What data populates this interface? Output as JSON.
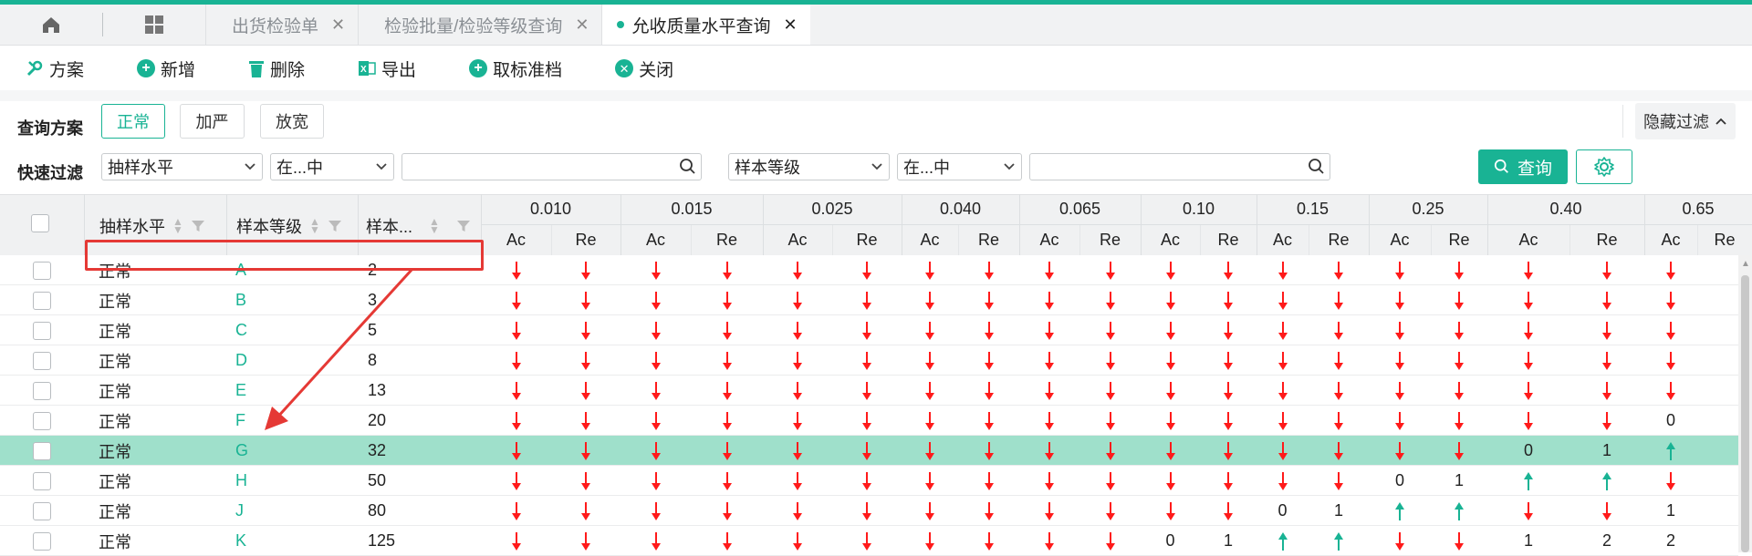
{
  "tabs": {
    "items": [
      {
        "label": "出货检验单"
      },
      {
        "label": "检验批量/检验等级查询"
      },
      {
        "label": "允收质量水平查询"
      }
    ]
  },
  "toolbar": {
    "scheme": "方案",
    "add": "新增",
    "delete": "删除",
    "export": "导出",
    "cancel_std": "取标准档",
    "close": "关闭"
  },
  "query": {
    "scheme_label": "查询方案",
    "chips": [
      "正常",
      "加严",
      "放宽"
    ],
    "hide_filter": "隐藏过滤",
    "quick_label": "快速过滤",
    "field1": "抽样水平",
    "op1": "在...中",
    "field2": "样本等级",
    "op2": "在...中",
    "search": "查询"
  },
  "grid": {
    "col_level": "抽样水平",
    "col_grade": "样本等级",
    "col_size": "样本...",
    "aql": [
      "0.010",
      "0.015",
      "0.025",
      "0.040",
      "0.065",
      "0.10",
      "0.15",
      "0.25",
      "0.40",
      "0.65"
    ],
    "ac": "Ac",
    "re": "Re",
    "rows": [
      {
        "level": "正常",
        "grade": "A",
        "size": "2",
        "cells": [
          "d",
          "d",
          "d",
          "d",
          "d",
          "d",
          "d",
          "d",
          "d",
          "d",
          "d",
          "d",
          "d",
          "d",
          "d",
          "d",
          "d",
          "d",
          "d"
        ]
      },
      {
        "level": "正常",
        "grade": "B",
        "size": "3",
        "cells": [
          "d",
          "d",
          "d",
          "d",
          "d",
          "d",
          "d",
          "d",
          "d",
          "d",
          "d",
          "d",
          "d",
          "d",
          "d",
          "d",
          "d",
          "d",
          "d"
        ]
      },
      {
        "level": "正常",
        "grade": "C",
        "size": "5",
        "cells": [
          "d",
          "d",
          "d",
          "d",
          "d",
          "d",
          "d",
          "d",
          "d",
          "d",
          "d",
          "d",
          "d",
          "d",
          "d",
          "d",
          "d",
          "d",
          "d"
        ]
      },
      {
        "level": "正常",
        "grade": "D",
        "size": "8",
        "cells": [
          "d",
          "d",
          "d",
          "d",
          "d",
          "d",
          "d",
          "d",
          "d",
          "d",
          "d",
          "d",
          "d",
          "d",
          "d",
          "d",
          "d",
          "d",
          "d"
        ]
      },
      {
        "level": "正常",
        "grade": "E",
        "size": "13",
        "cells": [
          "d",
          "d",
          "d",
          "d",
          "d",
          "d",
          "d",
          "d",
          "d",
          "d",
          "d",
          "d",
          "d",
          "d",
          "d",
          "d",
          "d",
          "d",
          "d"
        ]
      },
      {
        "level": "正常",
        "grade": "F",
        "size": "20",
        "cells": [
          "d",
          "d",
          "d",
          "d",
          "d",
          "d",
          "d",
          "d",
          "d",
          "d",
          "d",
          "d",
          "d",
          "d",
          "d",
          "d",
          "d",
          "d",
          "0"
        ]
      },
      {
        "level": "正常",
        "grade": "G",
        "size": "32",
        "cells": [
          "d",
          "d",
          "d",
          "d",
          "d",
          "d",
          "d",
          "d",
          "d",
          "d",
          "d",
          "d",
          "d",
          "d",
          "d",
          "d",
          "0",
          "1",
          "u"
        ]
      },
      {
        "level": "正常",
        "grade": "H",
        "size": "50",
        "cells": [
          "d",
          "d",
          "d",
          "d",
          "d",
          "d",
          "d",
          "d",
          "d",
          "d",
          "d",
          "d",
          "d",
          "d",
          "0",
          "1",
          "u",
          "u",
          "d"
        ]
      },
      {
        "level": "正常",
        "grade": "J",
        "size": "80",
        "cells": [
          "d",
          "d",
          "d",
          "d",
          "d",
          "d",
          "d",
          "d",
          "d",
          "d",
          "d",
          "d",
          "0",
          "1",
          "u",
          "u",
          "d",
          "d",
          "1"
        ]
      },
      {
        "level": "正常",
        "grade": "K",
        "size": "125",
        "cells": [
          "d",
          "d",
          "d",
          "d",
          "d",
          "d",
          "d",
          "d",
          "d",
          "d",
          "0",
          "1",
          "u",
          "u",
          "d",
          "d",
          "1",
          "2",
          "2"
        ]
      }
    ],
    "selected_row": 6
  },
  "colors": {
    "accent": "#19b394",
    "arrow_red": "#ff0000",
    "selected_row": "#9fe0cb",
    "highlight_box": "#e53935"
  }
}
